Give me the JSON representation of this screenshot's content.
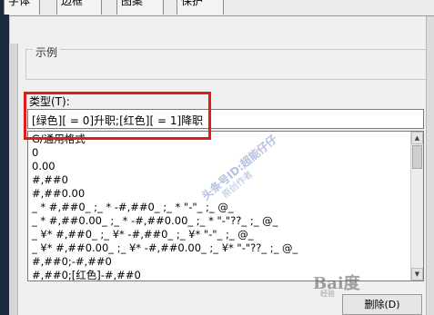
{
  "tabs": [
    {
      "label": "字体",
      "visible": "字体"
    },
    {
      "label": "边框",
      "visible": "边框"
    },
    {
      "label": "图案",
      "visible": "图案"
    },
    {
      "label": "保护",
      "visible": "保护"
    }
  ],
  "sample": {
    "label": "示例"
  },
  "type_field": {
    "label": "类型(T):",
    "value": "[绿色][ = 0]升职;[红色][ = 1]降职"
  },
  "format_list": {
    "items": [
      "G/通用格式",
      "0",
      "0.00",
      "#,##0",
      "#,##0.00",
      "_ * #,##0_ ;_ * -#,##0_ ;_ * \"-\"_ ;_ @_",
      "_ * #,##0.00_ ;_ * -#,##0.00_ ;_ * \"-\"??_ ;_ @_",
      "_ ¥* #,##0_ ;_ ¥* -#,##0_ ;_ ¥* \"-\"_ ;_ @_",
      "_ ¥* #,##0.00_ ;_ ¥* -#,##0.00_ ;_ ¥* \"-\"??_ ;_ @_",
      "#,##0;-#,##0",
      "#,##0;[红色]-#,##0"
    ]
  },
  "watermark": {
    "line1": "头条号ID:超能仔仔",
    "line2": "原创作者"
  },
  "delete_button": {
    "label": "删除(D)"
  },
  "logo": {
    "text": "Bai度",
    "sub": "经验"
  },
  "colors": {
    "highlight": "#e01b1b",
    "panel": "#f0f0f0",
    "dark_band": "#1b2a3d"
  }
}
